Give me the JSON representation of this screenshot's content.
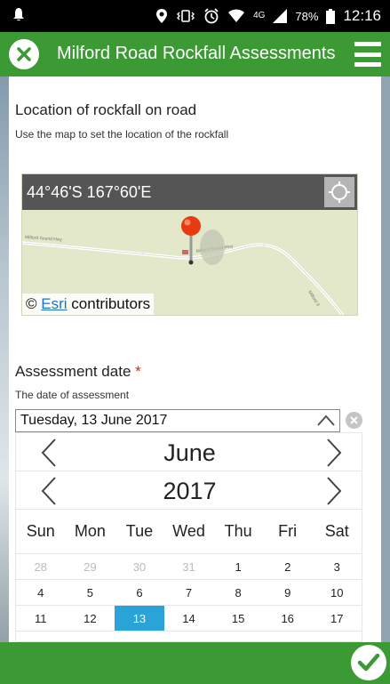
{
  "status": {
    "battery_pct": "78%",
    "network": "4G",
    "time": "12:16"
  },
  "app_bar": {
    "title": "Milford Road Rockfall Assessments"
  },
  "location": {
    "title": "Location of rockfall on road",
    "subtitle": "Use the map to set the location of the rockfall",
    "coordinates": "44°46'S 167°60'E",
    "road_label_1": "Milford Sound Hwy",
    "road_label_2": "Milford Sound Hwy",
    "road_label_3": "Milford S",
    "attribution_prefix": "©",
    "attribution_link": "Esri",
    "attribution_suffix": "contributors"
  },
  "assessment": {
    "title": "Assessment date",
    "required_mark": "*",
    "subtitle": "The date of assessment",
    "value": "Tuesday, 13 June 2017"
  },
  "calendar": {
    "month": "June",
    "year": "2017",
    "weekdays": [
      "Sun",
      "Mon",
      "Tue",
      "Wed",
      "Thu",
      "Fri",
      "Sat"
    ],
    "weeks": [
      [
        "28",
        "29",
        "30",
        "31",
        "1",
        "2",
        "3"
      ],
      [
        "4",
        "5",
        "6",
        "7",
        "8",
        "9",
        "10"
      ],
      [
        "11",
        "12",
        "13",
        "14",
        "15",
        "16",
        "17"
      ]
    ],
    "selected": "13",
    "accent": "#29a3d8"
  },
  "colors": {
    "app_green": "#3c9a35"
  },
  "icons": {
    "close": "close-icon",
    "menu": "menu-icon",
    "locate": "locate-icon",
    "pin": "map-pin-icon",
    "submit": "checkmark-icon",
    "clear": "clear-icon"
  }
}
